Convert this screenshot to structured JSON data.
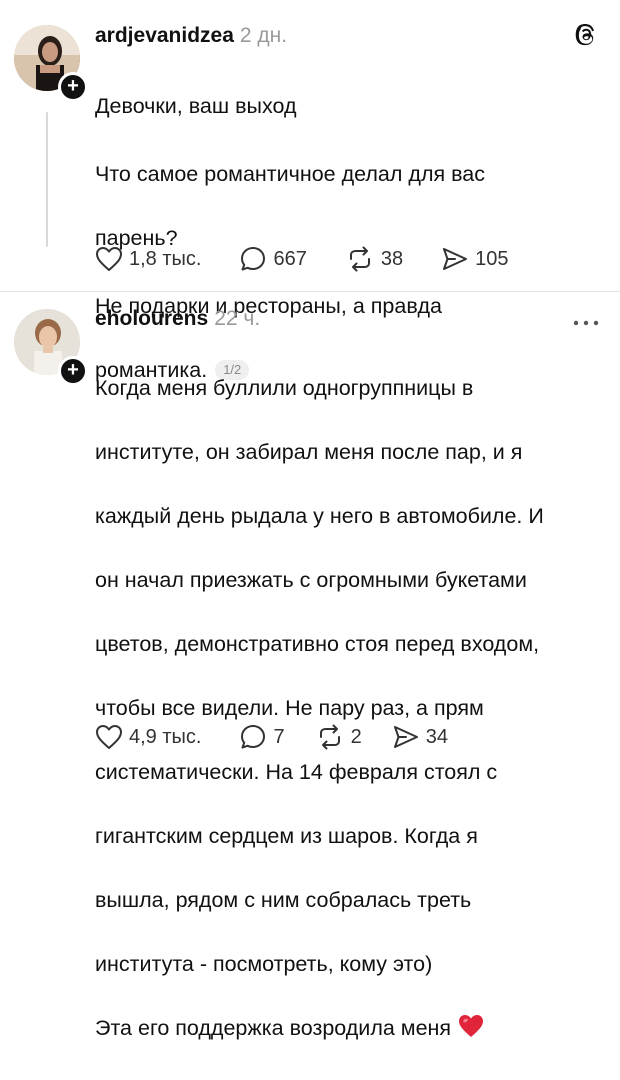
{
  "posts": [
    {
      "username": "ardjevanidzea",
      "time": "2 дн.",
      "lines": [
        "Девочки, ваш выход",
        "Что самое романтичное делал для вас",
        "парень?",
        " Не подарки и рестораны, а правда",
        "романтика."
      ],
      "counter": "1/2",
      "likes": "1,8 тыс.",
      "replies": "667",
      "reposts": "38",
      "shares": "105"
    },
    {
      "username": "eholourens",
      "time": "22 ч.",
      "lines": [
        "Когда меня буллили одногруппницы в",
        "институте, он забирал меня после пар, и я",
        "каждый день рыдала у него в автомобиле. И",
        "он начал приезжать с огромными букетами",
        "цветов, демонстративно стоя перед входом,",
        "чтобы все видели. Не пару раз, а прям",
        "систематически. На 14 февраля стоял с",
        "гигантским сердцем из шаров. Когда я",
        "вышла, рядом с ним собралась треть",
        "института - посмотреть, кому это)",
        "Эта его поддержка возродила меня"
      ],
      "likes": "4,9 тыс.",
      "replies": "7",
      "reposts": "2",
      "shares": "34"
    }
  ],
  "icons": {
    "app_logo": "threads-logo-icon",
    "more": "more-options-icon",
    "like": "heart-outline-icon",
    "reply": "speech-bubble-icon",
    "repost": "repost-arrows-icon",
    "share": "send-paper-plane-icon",
    "emoji": "red-heart-emoji-icon"
  },
  "colors": {
    "text": "#111111",
    "muted": "#9a9a9a",
    "heart_emoji": "#e0243a"
  }
}
